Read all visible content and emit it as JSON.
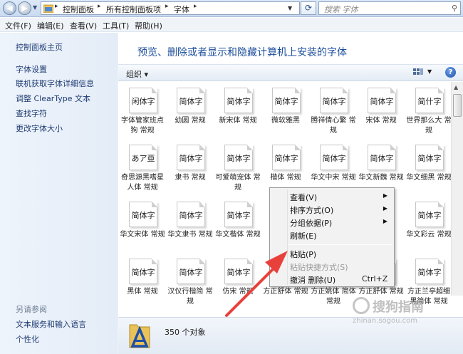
{
  "address": {
    "crumbs": [
      "控制面板",
      "所有控制面板项",
      "字体"
    ],
    "search_placeholder": "搜索 字体"
  },
  "menubar": [
    "文件(F)",
    "编辑(E)",
    "查看(V)",
    "工具(T)",
    "帮助(H)"
  ],
  "sidebar": {
    "home": "控制面板主页",
    "links": [
      "字体设置",
      "联机获取字体详细信息",
      "调整 ClearType 文本",
      "查找字符",
      "更改字体大小"
    ],
    "see_also_title": "另请参阅",
    "see_also": [
      "文本服务和输入语言",
      "个性化"
    ]
  },
  "main": {
    "heading": "预览、删除或者显示和隐藏计算机上安装的字体",
    "organize": "组织 ▾"
  },
  "fonts": [
    {
      "preview": "闲体字",
      "name": "字体管家班点狗 常规"
    },
    {
      "preview": "简体字",
      "name": "幼圆 常规"
    },
    {
      "preview": "简体字",
      "name": "新宋体 常规"
    },
    {
      "preview": "简体字",
      "name": "微软雅黑"
    },
    {
      "preview": "简体字",
      "name": "腾祥倩心繁 常规"
    },
    {
      "preview": "简体字",
      "name": "宋体 常规"
    },
    {
      "preview": "简什字",
      "name": "世界那么大 常规"
    },
    {
      "preview": "あア亜",
      "name": "奇思源黑嗜星人体 常规"
    },
    {
      "preview": "简体字",
      "name": "隶书 常规"
    },
    {
      "preview": "简体字",
      "name": "可爱萌宠体 常规"
    },
    {
      "preview": "简体字",
      "name": "楷体 常规"
    },
    {
      "preview": "简体字",
      "name": "华文中宋 常规"
    },
    {
      "preview": "简体字",
      "name": "华文新魏 常规"
    },
    {
      "preview": "简体字",
      "name": "华文细黑 常规"
    },
    {
      "preview": "简体字",
      "name": "华文宋体 常规"
    },
    {
      "preview": "简体字",
      "name": "华文隶书 常规"
    },
    {
      "preview": "简体字",
      "name": "华文楷体 常规"
    },
    {
      "preview": "",
      "name": ""
    },
    {
      "preview": "",
      "name": ""
    },
    {
      "preview": "",
      "name": ""
    },
    {
      "preview": "简体字",
      "name": "华文彩云 常规"
    },
    {
      "preview": "简体字",
      "name": "黑体 常规"
    },
    {
      "preview": "简体字",
      "name": "汉仪行楷简 常规"
    },
    {
      "preview": "简体字",
      "name": "仿宋 常规"
    },
    {
      "preview": "",
      "name": "方正舒体 常规"
    },
    {
      "preview": "",
      "name": "方正姚体 简体 常规"
    },
    {
      "preview": "",
      "name": "方正舒体 常规"
    },
    {
      "preview": "简体字",
      "name": "方正兰亭超细黑简体 常规"
    }
  ],
  "status": {
    "count": "350 个对象"
  },
  "context_menu": {
    "items": [
      {
        "label": "查看(V)",
        "submenu": "▶",
        "shortcut": ""
      },
      {
        "label": "排序方式(O)",
        "submenu": "▶",
        "shortcut": ""
      },
      {
        "label": "分组依据(P)",
        "submenu": "▶",
        "shortcut": ""
      },
      {
        "label": "刷新(E)",
        "submenu": "",
        "shortcut": ""
      },
      {
        "label": "粘贴(P)",
        "submenu": "",
        "shortcut": ""
      },
      {
        "label": "粘贴快捷方式(S)",
        "submenu": "",
        "shortcut": ""
      },
      {
        "label": "撤消 删除(U)",
        "submenu": "",
        "shortcut": "Ctrl+Z"
      }
    ]
  },
  "watermark": {
    "main": "搜狗指南",
    "sub": "zhinan.sogou.com"
  },
  "colors": {
    "accent": "#1e4f9c",
    "arrow": "#e8413c"
  }
}
